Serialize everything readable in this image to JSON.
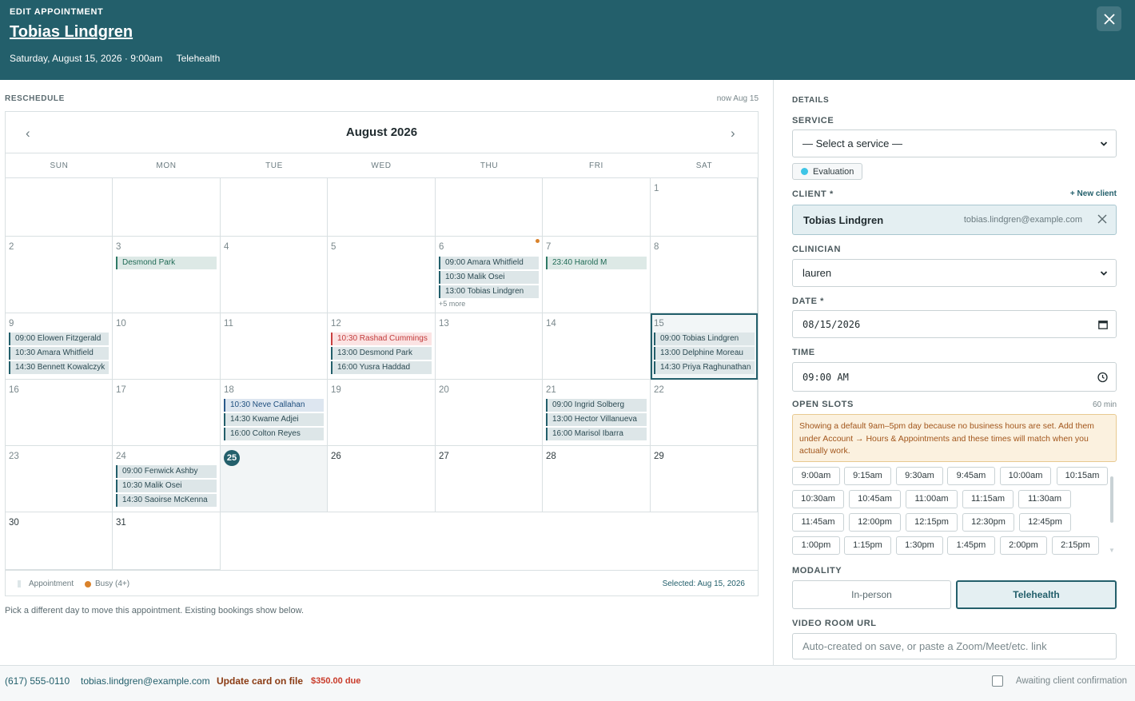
{
  "header": {
    "eyebrow": "EDIT APPOINTMENT",
    "client_name": "Tobias Lindgren",
    "datetime": "Saturday, August 15, 2026 · 9:00am",
    "modality": "Telehealth"
  },
  "calendar": {
    "section_label": "RESCHEDULE",
    "now_label": "now Aug 15",
    "month": "August 2026",
    "prev_icon": "‹",
    "next_icon": "›",
    "dow": [
      "SUN",
      "MON",
      "TUE",
      "WED",
      "THU",
      "FRI",
      "SAT"
    ],
    "days": {
      "d1": "1",
      "d2": "2",
      "d3": "3",
      "d4": "4",
      "d5": "5",
      "d6": "6",
      "d7": "7",
      "d8": "8",
      "d9": "9",
      "d10": "10",
      "d11": "11",
      "d12": "12",
      "d13": "13",
      "d14": "14",
      "d15": "15",
      "d16": "16",
      "d17": "17",
      "d18": "18",
      "d19": "19",
      "d20": "20",
      "d21": "21",
      "d22": "22",
      "d23": "23",
      "d24": "24",
      "d25": "25",
      "d26": "26",
      "d27": "27",
      "d28": "28",
      "d29": "29",
      "d30": "30",
      "d31": "31"
    },
    "appointments": {
      "d3": [
        "Desmond Park"
      ],
      "d6": [
        "09:00 Amara Whitfield",
        "10:30 Malik Osei",
        "13:00 Tobias Lindgren"
      ],
      "d6_more": "+5 more",
      "d7": [
        "23:40 Harold M"
      ],
      "d9": [
        "09:00 Elowen Fitzgerald",
        "10:30 Amara Whitfield",
        "14:30 Bennett Kowalczyk"
      ],
      "d12": [
        "10:30 Rashad Cummings",
        "13:00 Desmond Park",
        "16:00 Yusra Haddad"
      ],
      "d15": [
        "09:00 Tobias Lindgren",
        "13:00 Delphine Moreau",
        "14:30 Priya Raghunathan"
      ],
      "d18": [
        "10:30 Neve Callahan",
        "14:30 Kwame Adjei",
        "16:00 Colton Reyes"
      ],
      "d21": [
        "09:00 Ingrid Solberg",
        "13:00 Hector Villanueva",
        "16:00 Marisol Ibarra"
      ],
      "d24": [
        "09:00 Fenwick Ashby",
        "10:30 Malik Osei",
        "14:30 Saoirse McKenna"
      ]
    },
    "legend": {
      "appointment": "Appointment",
      "busy": "Busy (4+)"
    },
    "selected_label": "Selected: Aug 15, 2026",
    "hint": "Pick a different day to move this appointment. Existing bookings show below."
  },
  "details": {
    "section_label": "DETAILS",
    "service_label": "SERVICE",
    "service_value": "— Select a service —",
    "service_chip": "Evaluation",
    "client_label": "CLIENT *",
    "new_client": "+ New client",
    "client_name": "Tobias Lindgren",
    "client_email": "tobias.lindgren@example.com",
    "clinician_label": "CLINICIAN",
    "clinician_value": "lauren",
    "date_label": "DATE *",
    "date_value": "08/15/2026",
    "time_label": "TIME",
    "time_value": "09:00 AM",
    "open_slots_label": "OPEN SLOTS",
    "slot_duration": "60 min",
    "warning": "Showing a default 9am–5pm day because no business hours are set. Add them under Account → Hours & Appointments and these times will match when you actually work.",
    "slots": [
      "9:00am",
      "9:15am",
      "9:30am",
      "9:45am",
      "10:00am",
      "10:15am",
      "10:30am",
      "10:45am",
      "11:00am",
      "11:15am",
      "11:30am",
      "11:45am",
      "12:00pm",
      "12:15pm",
      "12:30pm",
      "12:45pm",
      "1:00pm",
      "1:15pm",
      "1:30pm",
      "1:45pm",
      "2:00pm",
      "2:15pm"
    ],
    "modality_label": "MODALITY",
    "modality_inperson": "In-person",
    "modality_telehealth": "Telehealth",
    "video_label": "VIDEO ROOM URL",
    "video_placeholder": "Auto-created on save, or paste a Zoom/Meet/etc. link"
  },
  "footer": {
    "phone": "(617) 555-0110",
    "email": "tobias.lindgren@example.com",
    "update_card": "Update card on file",
    "due": "$350.00 due",
    "awaiting": "Awaiting client confirmation"
  },
  "colors": {
    "brand": "#235f6b",
    "busy": "#d9822b",
    "warning_bg": "#fbf1df"
  },
  "icons": {
    "close": "close-icon",
    "calendar": "calendar-icon",
    "clock": "clock-icon",
    "chevron": "chevron-down-icon"
  }
}
